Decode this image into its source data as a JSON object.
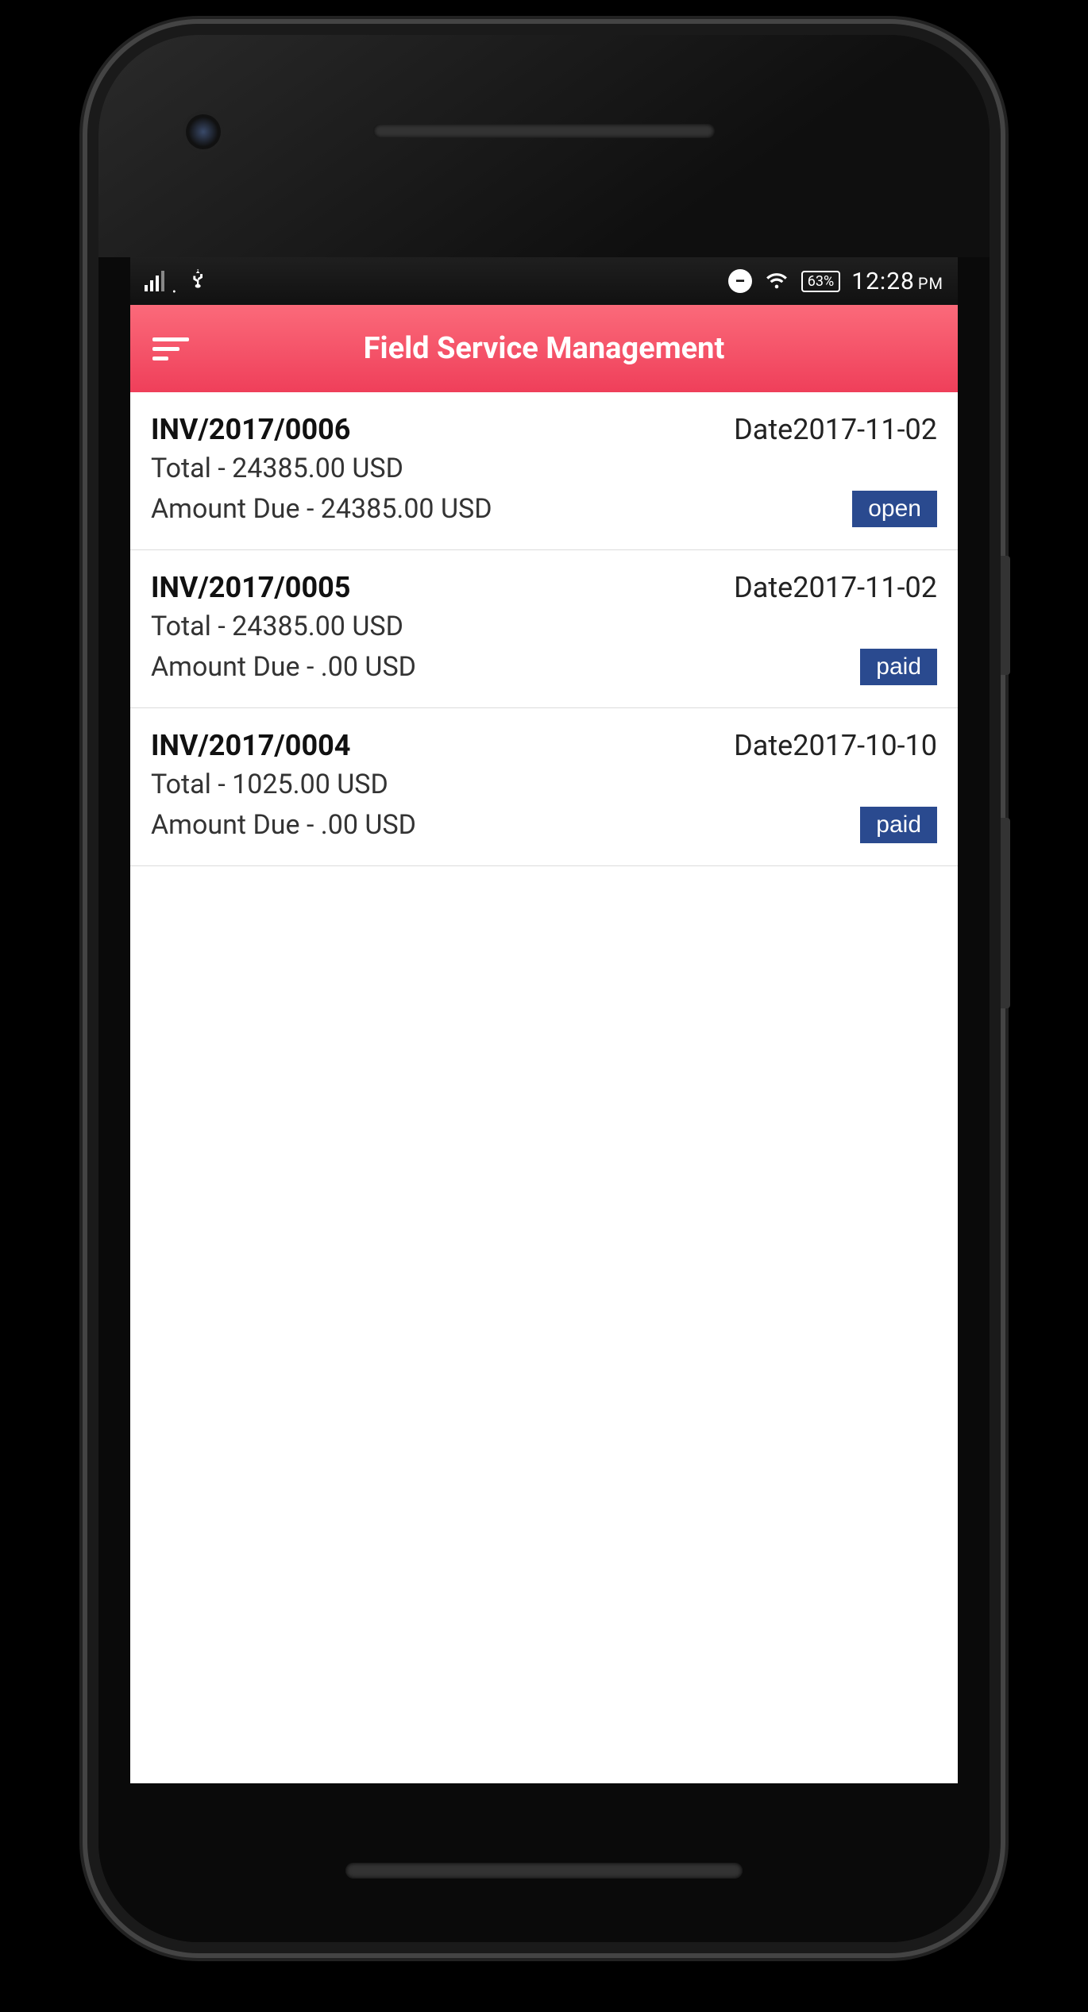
{
  "status_bar": {
    "battery": "63%",
    "time": "12:28",
    "time_suffix": "PM"
  },
  "header": {
    "title": "Field Service Management"
  },
  "invoices": [
    {
      "number": "INV/2017/0006",
      "date": "Date2017-11-02",
      "total": "Total - 24385.00 USD",
      "due": "Amount Due - 24385.00 USD",
      "status": "open"
    },
    {
      "number": "INV/2017/0005",
      "date": "Date2017-11-02",
      "total": "Total - 24385.00 USD",
      "due": "Amount Due - .00 USD",
      "status": "paid"
    },
    {
      "number": "INV/2017/0004",
      "date": "Date2017-10-10",
      "total": "Total - 1025.00 USD",
      "due": "Amount Due - .00 USD",
      "status": "paid"
    }
  ]
}
